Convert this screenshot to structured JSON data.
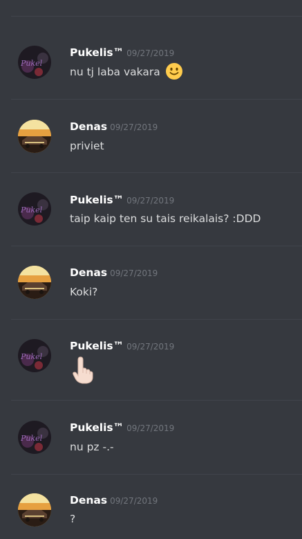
{
  "messages": [
    {
      "author": "Pukelis™",
      "timestamp": "09/27/2019",
      "text": "nu tj laba vakara",
      "emoji": "slightly-smiling-face",
      "avatar": "pukelis"
    },
    {
      "author": "Denas",
      "timestamp": "09/27/2019",
      "text": "priviet",
      "avatar": "denas"
    },
    {
      "author": "Pukelis™",
      "timestamp": "09/27/2019",
      "text": "taip kaip ten su tais reikalais? :DDD",
      "avatar": "pukelis"
    },
    {
      "author": "Denas",
      "timestamp": "09/27/2019",
      "text": "Koki?",
      "avatar": "denas"
    },
    {
      "author": "Pukelis™",
      "timestamp": "09/27/2019",
      "text": "",
      "emoji": "point-up-hand",
      "avatar": "pukelis"
    },
    {
      "author": "Pukelis™",
      "timestamp": "09/27/2019",
      "text": "nu pz -.-",
      "avatar": "pukelis"
    },
    {
      "author": "Denas",
      "timestamp": "09/27/2019",
      "text": "?",
      "avatar": "denas"
    }
  ],
  "colors": {
    "background": "#36393f",
    "divider": "#40444b",
    "author": "#ffffff",
    "timestamp": "#72767d",
    "text": "#dcddde"
  }
}
